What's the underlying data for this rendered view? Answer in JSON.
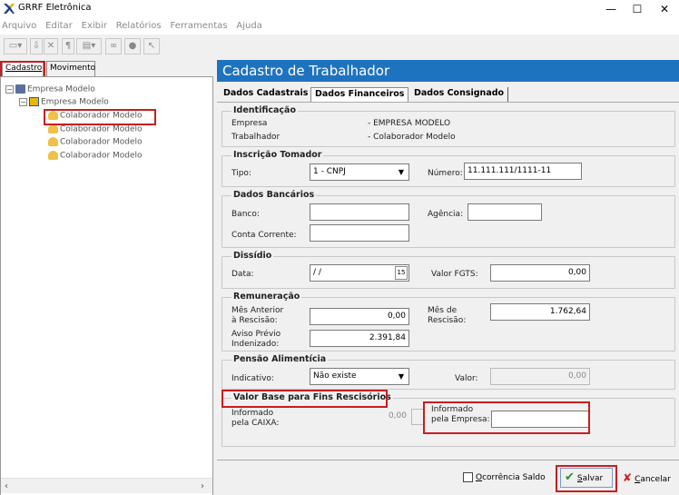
{
  "window": {
    "title": "GRRF Eletrônica",
    "minimize": "—",
    "maximize": "☐",
    "close": "✕"
  },
  "menu": [
    "Arquivo",
    "Editar",
    "Exibir",
    "Relatórios",
    "Ferramentas",
    "Ajuda"
  ],
  "left_tabs": {
    "cadastro": "Cadastro",
    "movimento": "Movimento"
  },
  "tree": {
    "root": "Empresa Modelo",
    "company": "Empresa Modelo",
    "workers": [
      "Colaborador Modelo",
      "Colaborador Modelo",
      "Colaborador Modelo",
      "Colaborador Modelo"
    ]
  },
  "panel": {
    "title": "Cadastro de Trabalhador",
    "tabs": [
      "Dados Cadastrais",
      "Dados Financeiros",
      "Dados Consignado"
    ],
    "identificacao": {
      "title": "Identificação",
      "empresa_label": "Empresa",
      "empresa_value": "- EMPRESA MODELO",
      "trabalhador_label": "Trabalhador",
      "trabalhador_value": "- Colaborador Modelo"
    },
    "inscricao": {
      "title": "Inscrição Tomador",
      "tipo_label": "Tipo:",
      "tipo_value": "1 - CNPJ",
      "numero_label": "Número:",
      "numero_value": "11.111.111/1111-11"
    },
    "bancarios": {
      "title": "Dados Bancários",
      "banco_label": "Banco:",
      "agencia_label": "Agência:",
      "conta_label": "Conta Corrente:"
    },
    "dissidio": {
      "title": "Dissídio",
      "data_label": "Data:",
      "data_value": "/ /",
      "calendar_glyph": "15",
      "fgts_label": "Valor FGTS:",
      "fgts_value": "0,00"
    },
    "remuneracao": {
      "title": "Remuneração",
      "mes_anterior_label_1": "Mês Anterior",
      "mes_anterior_label_2": "à Rescisão:",
      "mes_anterior_value": "0,00",
      "mes_rescisao_label_1": "Mês de",
      "mes_rescisao_label_2": "Rescisão:",
      "mes_rescisao_value": "1.762,64",
      "aviso_label_1": "Aviso Prévio",
      "aviso_label_2": "Indenizado:",
      "aviso_value": "2.391,84"
    },
    "pensao": {
      "title": "Pensão Alimentícia",
      "indicativo_label": "Indicativo:",
      "indicativo_value": "Não existe",
      "valor_label": "Valor:",
      "valor_value": "0,00"
    },
    "valor_base": {
      "title": "Valor Base para Fins Rescisórios",
      "caixa_label_1": "Informado",
      "caixa_label_2": "pela CAIXA:",
      "caixa_value": "0,00",
      "empresa_label_1": "Informado",
      "empresa_label_2": "pela Empresa:",
      "empresa_value": ""
    }
  },
  "buttons": {
    "ocorrencia_pre": "",
    "ocorrencia_u": "O",
    "ocorrencia_post": "corrência Saldo",
    "salvar_u": "S",
    "salvar_post": "alvar",
    "cancelar_u": "C",
    "cancelar_post": "ancelar"
  },
  "colors": {
    "accent": "#1e73be",
    "highlight": "#c81e1e"
  }
}
